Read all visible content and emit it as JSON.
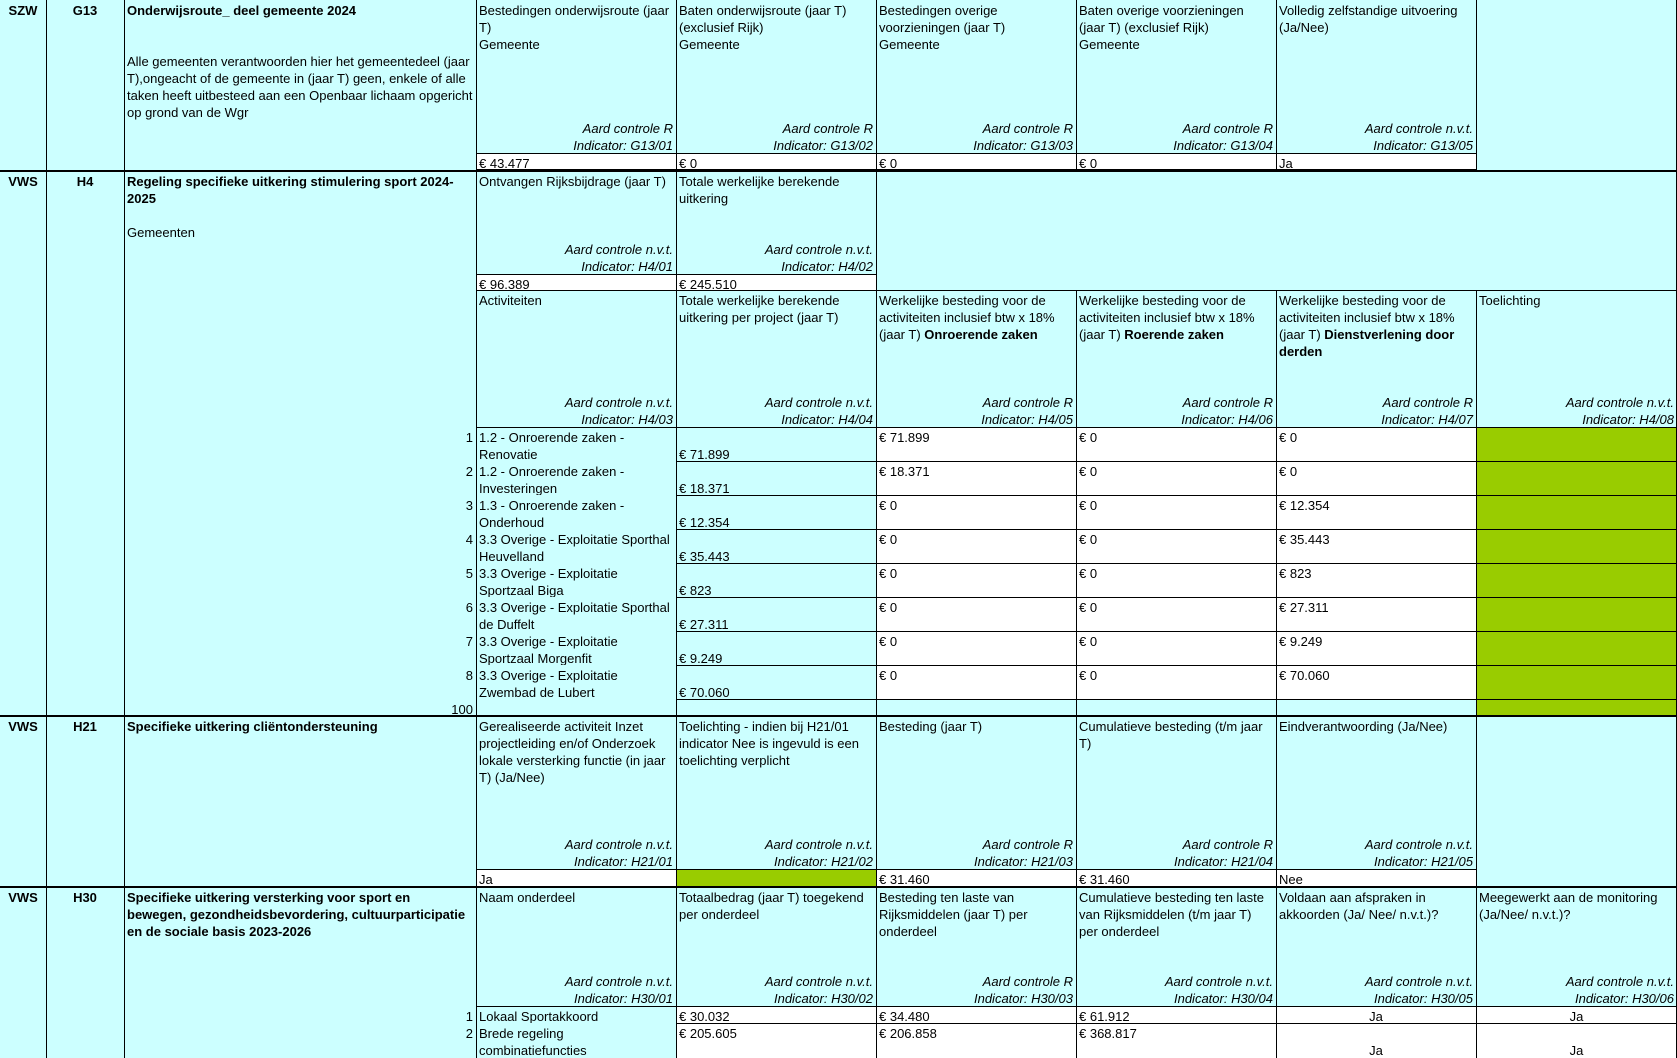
{
  "rows": {
    "g13": {
      "dept": "SZW",
      "code": "G13",
      "title": "Onderwijsroute_ deel gemeente 2024",
      "desc": "Alle gemeenten verantwoorden hier het gemeentedeel (jaar T),ongeacht of de gemeente in (jaar T) geen, enkele of alle taken heeft uitbesteed aan een Openbaar lichaam opgericht op grond van de Wgr",
      "cols": [
        {
          "head": "Bestedingen onderwijsroute (jaar T)",
          "sub": "Gemeente",
          "control": "Aard controle R",
          "indicator": "Indicator: G13/01",
          "value": "€ 43.477"
        },
        {
          "head": "Baten onderwijsroute (jaar T) (exclusief Rijk)",
          "sub": "Gemeente",
          "control": "Aard controle R",
          "indicator": "Indicator: G13/02",
          "value": "€ 0"
        },
        {
          "head": "Bestedingen overige voorzieningen (jaar T)",
          "sub": "Gemeente",
          "control": "Aard controle R",
          "indicator": "Indicator: G13/03",
          "value": "€ 0"
        },
        {
          "head": "Baten overige voorzieningen (jaar T) (exclusief Rijk)",
          "sub": "Gemeente",
          "control": "Aard controle R",
          "indicator": "Indicator: G13/04",
          "value": "€ 0"
        },
        {
          "head": "Volledig zelfstandige uitvoering (Ja/Nee)",
          "sub": "",
          "control": "Aard controle n.v.t.",
          "indicator": "Indicator: G13/05",
          "value": "Ja"
        }
      ]
    },
    "h4": {
      "dept": "VWS",
      "code": "H4",
      "title": "Regeling specifieke uitkering stimulering sport 2024-2025",
      "desc": "Gemeenten",
      "top_cols": [
        {
          "head": "Ontvangen Rijksbijdrage (jaar T)",
          "control": "Aard controle n.v.t.",
          "indicator": "Indicator: H4/01",
          "value": "€ 96.389"
        },
        {
          "head": "Totale werkelijke berekende uitkering",
          "control": "Aard controle n.v.t.",
          "indicator": "Indicator: H4/02",
          "value": "€ 245.510"
        }
      ],
      "table_heads": [
        {
          "head": "Activiteiten",
          "bold": "",
          "control": "Aard controle n.v.t.",
          "indicator": "Indicator: H4/03"
        },
        {
          "head": "Totale werkelijke berekende uitkering per project (jaar T)",
          "bold": "",
          "control": "Aard controle n.v.t.",
          "indicator": "Indicator: H4/04"
        },
        {
          "head": "Werkelijke besteding voor de activiteiten inclusief btw x 18% (jaar T) ",
          "bold": "Onroerende zaken",
          "control": "Aard controle R",
          "indicator": "Indicator: H4/05"
        },
        {
          "head": "Werkelijke besteding voor de activiteiten inclusief btw x 18% (jaar T) ",
          "bold": "Roerende zaken",
          "control": "Aard controle R",
          "indicator": "Indicator: H4/06"
        },
        {
          "head": "Werkelijke besteding voor de activiteiten inclusief btw x 18% (jaar T) ",
          "bold": "Dienstverlening door derden",
          "control": "Aard controle R",
          "indicator": "Indicator: H4/07"
        },
        {
          "head": "Toelichting",
          "bold": "",
          "control": "Aard controle n.v.t.",
          "indicator": "Indicator: H4/08"
        }
      ],
      "table_rows": [
        {
          "n": "1",
          "activity": "1.2 - Onroerende zaken - Renovatie",
          "uitkering": "€ 71.899",
          "onroerend": "€ 71.899",
          "roerend": "€ 0",
          "derden": "€ 0"
        },
        {
          "n": "2",
          "activity": "1.2 - Onroerende zaken - Investeringen",
          "uitkering": "€ 18.371",
          "onroerend": "€ 18.371",
          "roerend": "€ 0",
          "derden": "€ 0"
        },
        {
          "n": "3",
          "activity": "1.3 - Onroerende zaken - Onderhoud",
          "uitkering": "€ 12.354",
          "onroerend": "€ 0",
          "roerend": "€ 0",
          "derden": "€ 12.354"
        },
        {
          "n": "4",
          "activity": "3.3 Overige - Exploitatie Sporthal Heuvelland",
          "uitkering": "€ 35.443",
          "onroerend": "€ 0",
          "roerend": "€ 0",
          "derden": "€ 35.443"
        },
        {
          "n": "5",
          "activity": "3.3 Overige - Exploitatie Sportzaal Biga",
          "uitkering": "€ 823",
          "onroerend": "€ 0",
          "roerend": "€ 0",
          "derden": "€ 823"
        },
        {
          "n": "6",
          "activity": "3.3 Overige - Exploitatie Sporthal de Duffelt",
          "uitkering": "€ 27.311",
          "onroerend": "€ 0",
          "roerend": "€ 0",
          "derden": "€ 27.311"
        },
        {
          "n": "7",
          "activity": "3.3 Overige - Exploitatie Sportzaal Morgenfit",
          "uitkering": "€ 9.249",
          "onroerend": "€ 0",
          "roerend": "€ 0",
          "derden": "€ 9.249"
        },
        {
          "n": "8",
          "activity": "3.3 Overige - Exploitatie Zwembad de Lubert",
          "uitkering": "€ 70.060",
          "onroerend": "€ 0",
          "roerend": "€ 0",
          "derden": "€ 70.060"
        }
      ],
      "total_label": "100"
    },
    "h21": {
      "dept": "VWS",
      "code": "H21",
      "title": "Specifieke uitkering cliëntondersteuning",
      "cols": [
        {
          "head": "Gerealiseerde activiteit Inzet projectleiding en/of Onderzoek lokale versterking functie (in jaar T) (Ja/Nee)",
          "control": "Aard controle n.v.t.",
          "indicator": "Indicator: H21/01",
          "value": "Ja"
        },
        {
          "head": "Toelichting - indien bij H21/01 indicator Nee is ingevuld is een toelichting verplicht",
          "control": "Aard controle n.v.t.",
          "indicator": "Indicator: H21/02",
          "value": ""
        },
        {
          "head": "Besteding (jaar T)",
          "control": "Aard controle R",
          "indicator": "Indicator: H21/03",
          "value": "€ 31.460"
        },
        {
          "head": "Cumulatieve besteding (t/m jaar T)",
          "control": "Aard controle R",
          "indicator": "Indicator: H21/04",
          "value": "€ 31.460"
        },
        {
          "head": "Eindverantwoording (Ja/Nee)",
          "control": "Aard controle n.v.t.",
          "indicator": "Indicator: H21/05",
          "value": "Nee"
        }
      ]
    },
    "h30": {
      "dept": "VWS",
      "code": "H30",
      "title": "Specifieke uitkering versterking voor sport en bewegen, gezondheidsbevordering, cultuurparticipatie en de sociale basis 2023-2026",
      "cols": [
        {
          "head": "Naam onderdeel",
          "control": "Aard controle n.v.t.",
          "indicator": "Indicator: H30/01"
        },
        {
          "head": "Totaalbedrag (jaar T) toegekend per onderdeel",
          "control": "Aard controle n.v.t.",
          "indicator": "Indicator: H30/02"
        },
        {
          "head": "Besteding ten laste van Rijksmiddelen (jaar T) per onderdeel",
          "control": "Aard controle R",
          "indicator": "Indicator: H30/03"
        },
        {
          "head": "Cumulatieve besteding ten laste van Rijksmiddelen (t/m jaar T) per onderdeel",
          "control": "Aard controle n.v.t.",
          "indicator": "Indicator: H30/04"
        },
        {
          "head": "Voldaan aan afspraken in akkoorden (Ja/ Nee/ n.v.t.)?",
          "control": "Aard controle n.v.t.",
          "indicator": "Indicator: H30/05"
        },
        {
          "head": "Meegewerkt aan de monitoring (Ja/Nee/ n.v.t.)?",
          "control": "Aard controle n.v.t.",
          "indicator": "Indicator: H30/06"
        }
      ],
      "rows": [
        {
          "n": "1",
          "name": "Lokaal Sportakkoord",
          "total": "€ 30.032",
          "besteding": "€ 34.480",
          "cumulatief": "€ 61.912",
          "voldaan": "Ja",
          "monitoring": "Ja"
        },
        {
          "n": "2",
          "name": "Brede regeling combinatiefuncties",
          "total": "€ 205.605",
          "besteding": "€ 206.858",
          "cumulatief": "€ 368.817",
          "voldaan": "Ja",
          "monitoring": "Ja"
        }
      ]
    }
  }
}
